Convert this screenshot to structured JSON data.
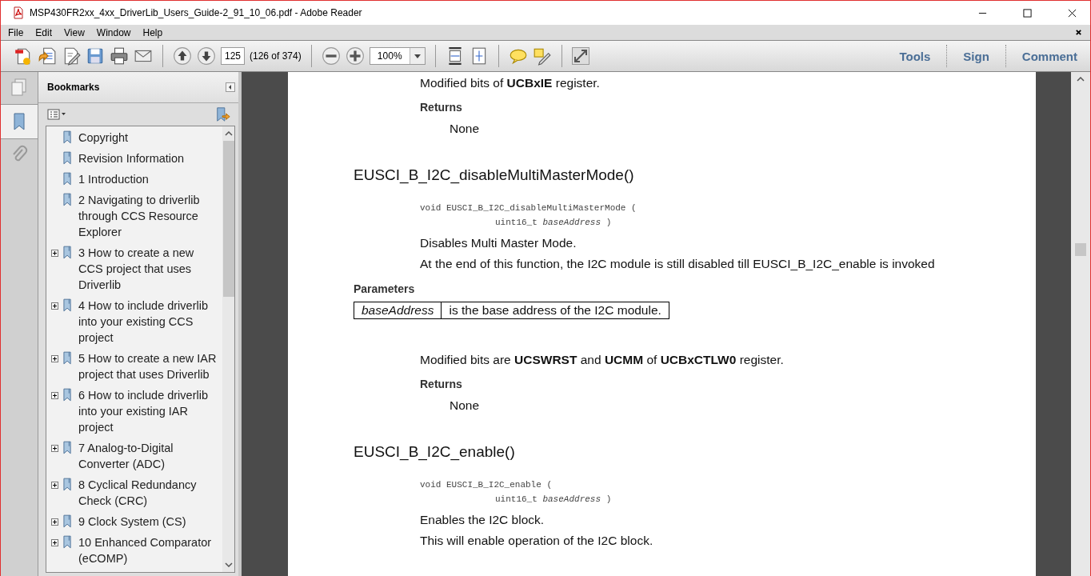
{
  "window": {
    "title": "MSP430FR2xx_4xx_DriverLib_Users_Guide-2_91_10_06.pdf - Adobe Reader"
  },
  "menu": [
    "File",
    "Edit",
    "View",
    "Window",
    "Help"
  ],
  "toolbar": {
    "page_number": "125",
    "page_count": "(126 of 374)",
    "zoom": "100%",
    "links": [
      "Tools",
      "Sign",
      "Comment"
    ]
  },
  "bookmarks": {
    "title": "Bookmarks",
    "items": [
      {
        "label": "Copyright",
        "expandable": false
      },
      {
        "label": "Revision Information",
        "expandable": false
      },
      {
        "label": "1 Introduction",
        "expandable": false
      },
      {
        "label": "2 Navigating to driverlib through CCS Resource Explorer",
        "expandable": false
      },
      {
        "label": "3 How to create a new CCS project that uses Driverlib",
        "expandable": true
      },
      {
        "label": "4 How to include driverlib into your existing CCS project",
        "expandable": true
      },
      {
        "label": "5 How to create a new IAR project that uses Driverlib",
        "expandable": true
      },
      {
        "label": "6 How to include driverlib into your existing IAR project",
        "expandable": true
      },
      {
        "label": "7 Analog-to-Digital Converter (ADC)",
        "expandable": true
      },
      {
        "label": "8 Cyclical Redundancy Check (CRC)",
        "expandable": true
      },
      {
        "label": "9 Clock System (CS)",
        "expandable": true
      },
      {
        "label": "10 Enhanced Comparator (eCOMP)",
        "expandable": true
      }
    ]
  },
  "document": [
    {
      "kind": "text",
      "text": "Modified bits of **UCBxIE** register."
    },
    {
      "kind": "label",
      "text": "Returns"
    },
    {
      "kind": "value",
      "text": "None"
    },
    {
      "kind": "heading",
      "text": "EUSCI_B_I2C_disableMultiMasterMode()"
    },
    {
      "kind": "signature",
      "text": "void EUSCI_B_I2C_disableMultiMasterMode (",
      "param_type": "uint16_t",
      "param_name": "baseAddress",
      "close": ")"
    },
    {
      "kind": "text",
      "text": "Disables Multi Master Mode."
    },
    {
      "kind": "text",
      "text": "At the end of this function, the I2C module is still disabled till EUSCI_B_I2C_enable is invoked"
    },
    {
      "kind": "section",
      "text": "Parameters"
    },
    {
      "kind": "param",
      "name": "baseAddress",
      "description": "is the base address of the I2C module."
    },
    {
      "kind": "text",
      "text": "Modified bits are **UCSWRST** and **UCMM** of **UCBxCTLW0** register."
    },
    {
      "kind": "label",
      "text": "Returns"
    },
    {
      "kind": "value",
      "text": "None"
    },
    {
      "kind": "heading",
      "text": "EUSCI_B_I2C_enable()"
    },
    {
      "kind": "signature",
      "text": "void EUSCI_B_I2C_enable (",
      "param_type": "uint16_t",
      "param_name": "baseAddress",
      "close": ")"
    },
    {
      "kind": "text",
      "text": "Enables the I2C block."
    },
    {
      "kind": "text",
      "text": "This will enable operation of the I2C block."
    }
  ]
}
